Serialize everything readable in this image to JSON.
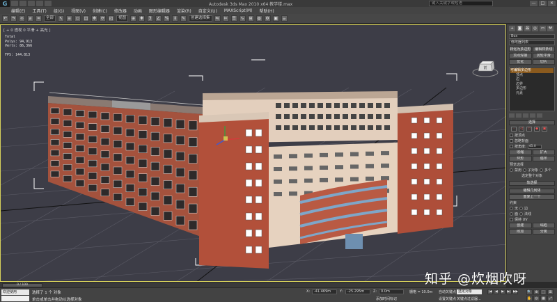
{
  "titlebar": {
    "logo": "G",
    "title": "Autodesk 3ds Max 2010 x64   教学楼.max",
    "search_placeholder": "键入关键字或短语",
    "window_buttons": [
      "—",
      "□",
      "✕"
    ]
  },
  "menu": [
    "编辑(E)",
    "工具(T)",
    "组(G)",
    "视图(V)",
    "创建(C)",
    "修改器",
    "动画",
    "图形编辑器",
    "渲染(R)",
    "自定义(U)",
    "MAXScript(M)",
    "帮助(H)"
  ],
  "toolbar": {
    "filter_value": "全部",
    "refcoord_value": "视图",
    "selset_value": "创建选择集"
  },
  "viewport": {
    "label": "[ + 0 透视 0 平滑 + 高光 ]",
    "stats": {
      "total_label": "Total",
      "polys": "Polys: 94,913",
      "verts": "Verts: 86,366",
      "fps": "FPS:  144.813"
    },
    "viewcube_label": "前"
  },
  "command_panel": {
    "tabs": [
      "+",
      "◙",
      "品",
      "◎",
      "▭",
      "⚒"
    ],
    "object_name": "Box",
    "modifier_list": "修改器列表",
    "buttons_row1": [
      "转化为多边形",
      "编辑样条线"
    ],
    "buttons_row2": [
      "顶点焊接",
      "涡轮平滑"
    ],
    "buttons_row3": [
      "优化",
      "切片"
    ],
    "stack": [
      {
        "label": "可编辑多边形",
        "selected": true,
        "child": false
      },
      {
        "label": "顶点",
        "selected": false,
        "child": true
      },
      {
        "label": "边",
        "selected": false,
        "child": true
      },
      {
        "label": "边界",
        "selected": false,
        "child": true
      },
      {
        "label": "多边形",
        "selected": false,
        "child": true
      },
      {
        "label": "元素",
        "selected": false,
        "child": true
      }
    ],
    "selection_rollout": "选择",
    "select_icons": [
      "·",
      "◁",
      "▭",
      "◆",
      "▣"
    ],
    "by_vertex": "按顶点",
    "ignore_backface": "忽略背面",
    "by_angle": "按角度:",
    "by_angle_value": "45.0",
    "shrink": "收缩",
    "grow": "扩大",
    "ring": "环形",
    "loop": "循环",
    "preview_label": "预览选择",
    "preview_opts": [
      "禁用",
      "子对象",
      "多个"
    ],
    "selected_count": "选定整个对象",
    "soft_sel_rollout": "软选择",
    "edit_geo_rollout": "编辑几何体",
    "repeat_last": "重复上一个",
    "constraints_label": "约束",
    "constraint_opts": [
      "无",
      "边",
      "面",
      "法线"
    ],
    "preserve_uv": "保持 UV",
    "create": "创建",
    "collapse": "塌陷",
    "attach": "附加",
    "detach": "分离"
  },
  "timeline": {
    "slider": "0 / 100"
  },
  "statusbar": {
    "script_label": "欢迎使用 MAXSc",
    "script_label2": "",
    "message": "选择了 1 个 对象",
    "prompt": "单击或单击并拖动以选择对象",
    "x_label": "X:",
    "x_value": "-41.469m",
    "y_label": "Y:",
    "y_value": "-25.295m",
    "z_label": "Z:",
    "z_value": "0.0m",
    "grid": "栅格 = 10.0m",
    "add_tag": "添加时间标记",
    "autokey": "自动关键点",
    "setkey": "设置关键点",
    "selected_obj": "选定对象",
    "key_filters": "关键点过滤器...",
    "play_ctrls": [
      "|◀",
      "◀",
      "▶",
      "▶|",
      "▶▶"
    ],
    "nav_ctrls": [
      "🔍",
      "⊕",
      "⬚",
      "⊞",
      "✋",
      "◎",
      "▦",
      "⤢"
    ]
  },
  "watermark": "知乎 @炊烟吹呀",
  "colors": {
    "viewport_bg": "#3d3d47",
    "brick": "#b2503a",
    "plaster": "#e6d2bf",
    "active_border": "#d9d35b",
    "selection_bracket": "#ffffff"
  }
}
